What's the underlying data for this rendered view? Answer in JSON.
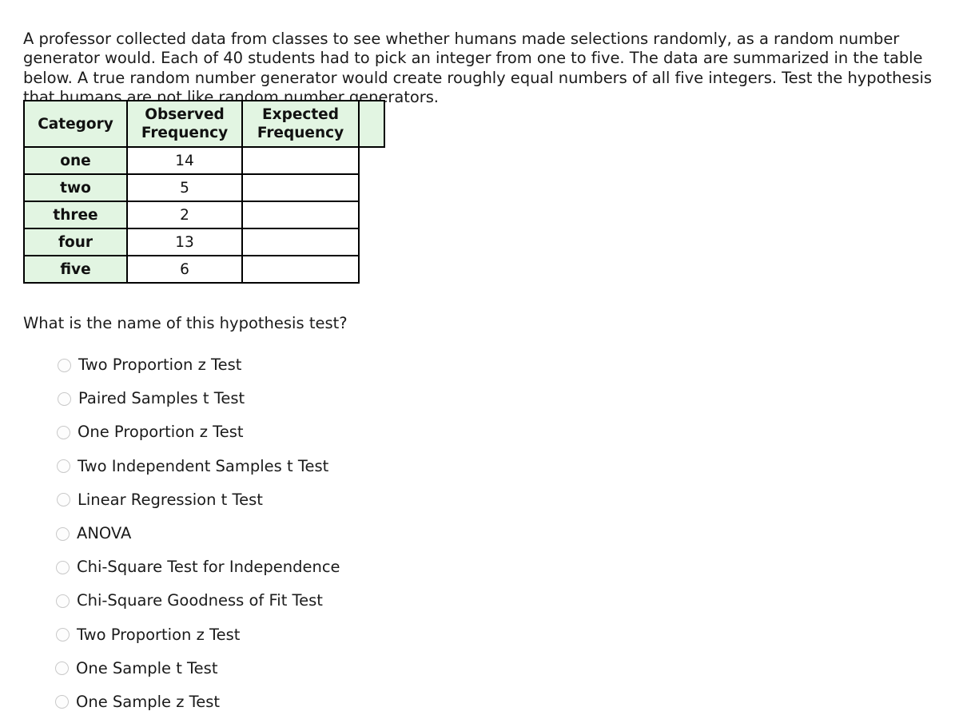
{
  "prompt": {
    "text": "A professor collected data from classes to see whether humans made selections randomly, as a random number generator would. Each of 40 students had to pick an integer from one to five. The data are summarized in the table below. A true random number generator would create roughly equal numbers of all five integers. Test the hypothesis that humans are not like random number generators."
  },
  "table": {
    "headers": [
      "Category",
      "Observed Frequency",
      "Expected Frequency",
      ""
    ],
    "header_lines": [
      [
        "Category"
      ],
      [
        "Observed",
        "Frequency"
      ],
      [
        "Expected",
        "Frequency"
      ],
      [
        ""
      ]
    ],
    "rows": [
      {
        "category": "one",
        "observed": "14",
        "expected": ""
      },
      {
        "category": "two",
        "observed": "5",
        "expected": ""
      },
      {
        "category": "three",
        "observed": "2",
        "expected": ""
      },
      {
        "category": "four",
        "observed": "13",
        "expected": ""
      },
      {
        "category": "five",
        "observed": "6",
        "expected": ""
      }
    ],
    "header_fill": "#e2f5e2",
    "border_color": "#000000"
  },
  "question": {
    "text": "What is the name of this hypothesis test?"
  },
  "options": [
    {
      "label": "Two Proportion z Test",
      "selected": false,
      "indent": 72
    },
    {
      "label": "Paired Samples t Test",
      "selected": false,
      "indent": 72
    },
    {
      "label": "One Proportion z Test",
      "selected": false,
      "indent": 71
    },
    {
      "label": "Two Independent Samples t Test",
      "selected": false,
      "indent": 71
    },
    {
      "label": "Linear Regression t Test",
      "selected": false,
      "indent": 71
    },
    {
      "label": "ANOVA",
      "selected": false,
      "indent": 70
    },
    {
      "label": "Chi-Square Test for Independence",
      "selected": false,
      "indent": 70
    },
    {
      "label": "Chi-Square Goodness of Fit Test",
      "selected": false,
      "indent": 70
    },
    {
      "label": "Two Proportion z Test",
      "selected": false,
      "indent": 70
    },
    {
      "label": "One Sample t Test",
      "selected": false,
      "indent": 69
    },
    {
      "label": "One Sample z Test",
      "selected": false,
      "indent": 69
    }
  ]
}
